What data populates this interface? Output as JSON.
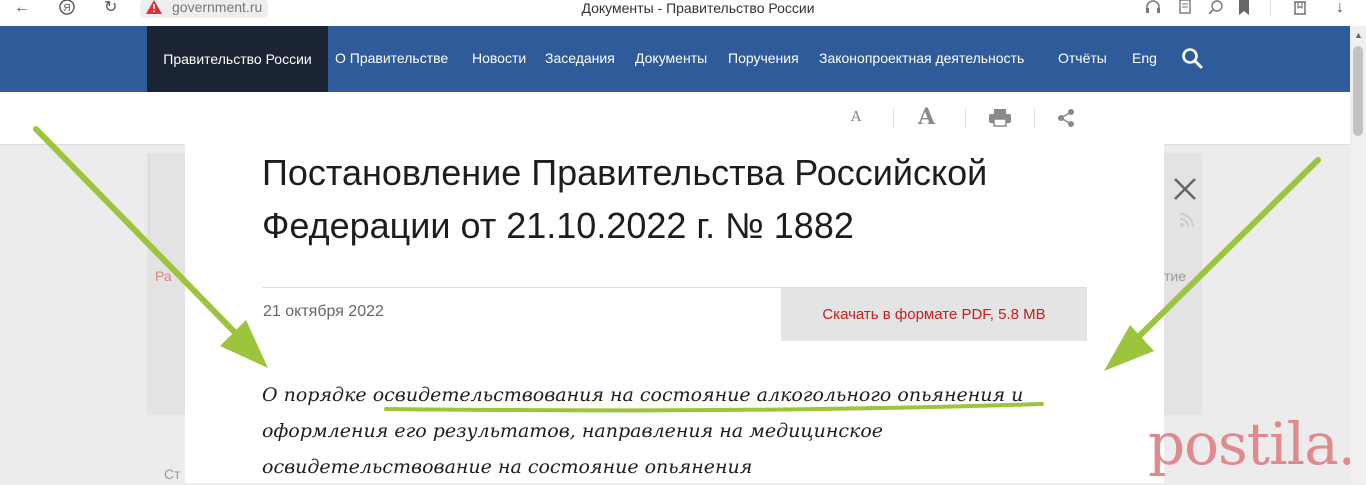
{
  "browser": {
    "url": "government.ru",
    "tab_title": "Документы - Правительство России"
  },
  "nav": {
    "brand": "Правительство России",
    "items": [
      "О Правительстве",
      "Новости",
      "Заседания",
      "Документы",
      "Поручения",
      "Законопроектная деятельность",
      "Отчёты",
      "Eng"
    ]
  },
  "background": {
    "left_link_fragment": "Ра",
    "right_fragment": "тие",
    "bottom_fragment": "Ст"
  },
  "document": {
    "title": "Постановление Правительства Российской Федерации от 21.10.2022 г. № 1882",
    "date": "21 октября 2022",
    "pdf_button": "Скачать в формате PDF, 5.8 MB",
    "description": "О порядке освидетельствования на состояние алкогольного опьянения и оформления его результатов, направления на медицинское освидетельствование на состояние опьянения"
  },
  "watermark": "postila.ru",
  "colors": {
    "nav_bg": "#2f5b9a",
    "brand_bg": "#1a2433",
    "pdf_text": "#c81e1e",
    "arrow": "#9cc43c",
    "watermark": "#e0898f"
  },
  "icons": [
    "back-icon",
    "yandex-icon",
    "reload-icon",
    "warning-icon",
    "headphones-icon",
    "reader-icon",
    "zoom-icon",
    "bookmark-icon",
    "collections-icon",
    "download-icon",
    "search-icon",
    "font-small-icon",
    "font-large-icon",
    "print-icon",
    "share-icon",
    "close-icon",
    "rss-icon"
  ]
}
